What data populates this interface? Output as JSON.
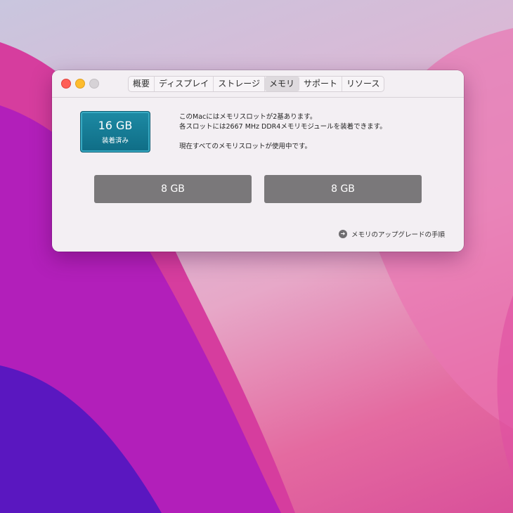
{
  "tabs": {
    "overview": "概要",
    "displays": "ディスプレイ",
    "storage": "ストレージ",
    "memory": "メモリ",
    "support": "サポート",
    "resources": "リソース"
  },
  "memory": {
    "total": "16 GB",
    "status": "装着済み",
    "line1": "このMacにはメモリスロットが2基あります。",
    "line2": "各スロットには2667 MHz DDR4メモリモジュールを装着できます。",
    "line3": "現在すべてのメモリスロットが使用中です。",
    "slots": [
      "8 GB",
      "8 GB"
    ],
    "upgrade_link": "メモリのアップグレードの手順"
  },
  "icons": {
    "upgrade": "arrow-circle-right-icon"
  }
}
